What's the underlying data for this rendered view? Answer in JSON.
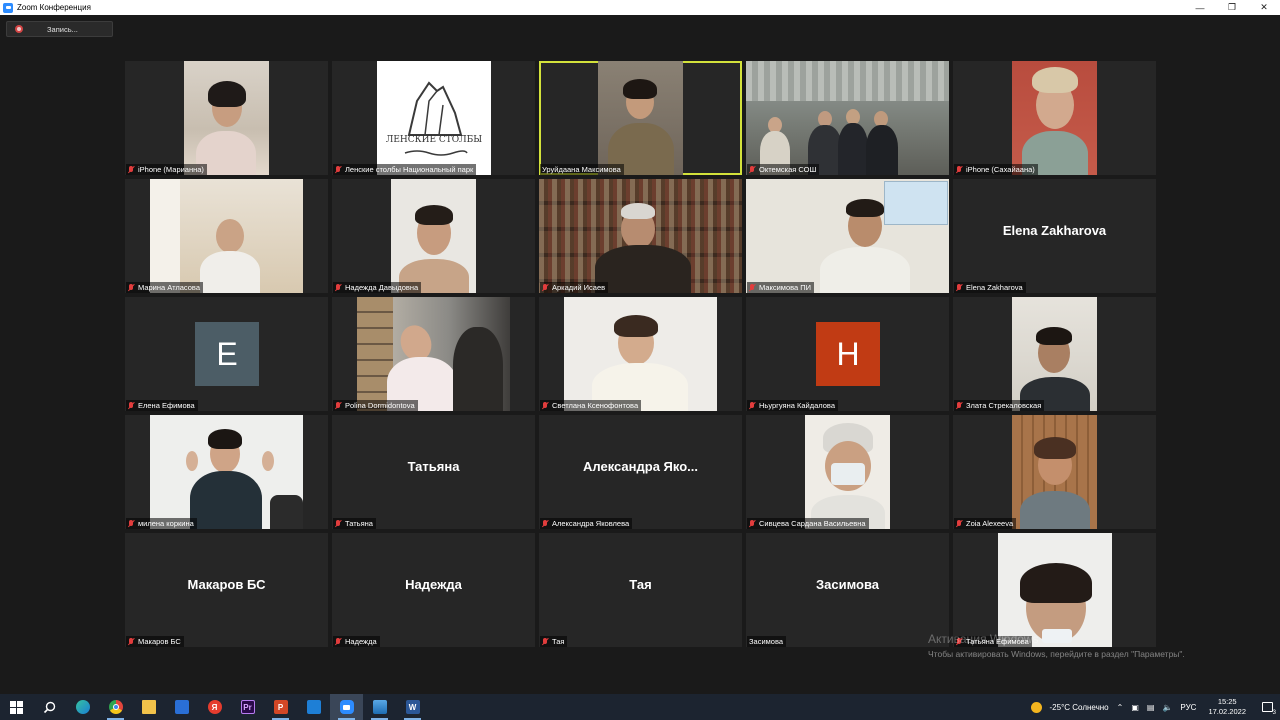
{
  "window": {
    "title": "Zoom Конференция",
    "controls": [
      "minimize-icon",
      "maximize-icon",
      "close-icon"
    ]
  },
  "recording": {
    "label": "Запись..."
  },
  "participants": [
    {
      "name": "iPhone (Марианна)",
      "show": "video"
    },
    {
      "name": "Ленские столбы Национальный парк",
      "show": "logo",
      "logo_text": "ЛЕНСКИЕ СТОЛБЫ"
    },
    {
      "name": "Уруйдаана Максимова",
      "show": "video",
      "active": true
    },
    {
      "name": "Октемская СОШ",
      "show": "video"
    },
    {
      "name": "iPhone (Сахайаана)",
      "show": "video"
    },
    {
      "name": "Марина Атласова",
      "show": "video"
    },
    {
      "name": "Надежда Давыдовна",
      "show": "video"
    },
    {
      "name": "Аркадий Исаев",
      "show": "video"
    },
    {
      "name": "Максимова ПИ",
      "show": "video"
    },
    {
      "name": "Elena Zakharova",
      "show": "name",
      "display": "Elena Zakharova"
    },
    {
      "name": "Елена Ефимова",
      "show": "avatar",
      "initial": "E",
      "color": "#4c5d66"
    },
    {
      "name": "Polina Dormidontova",
      "show": "video"
    },
    {
      "name": "Светлана Ксенофонтова",
      "show": "video"
    },
    {
      "name": "Ньургуяна Кайдалова",
      "show": "avatar",
      "initial": "H",
      "color": "#c13b14"
    },
    {
      "name": "Злата Стрекаловская",
      "show": "video"
    },
    {
      "name": "милена коркина",
      "show": "video"
    },
    {
      "name": "Татьяна",
      "show": "name",
      "display": "Татьяна"
    },
    {
      "name": "Александра Яковлева",
      "show": "name",
      "display": "Александра Яко..."
    },
    {
      "name": "Сивцева Сардана Васильевна",
      "show": "video"
    },
    {
      "name": "Zoia Alexeeva",
      "show": "video"
    },
    {
      "name": "Макаров БС",
      "show": "name",
      "display": "Макаров БС"
    },
    {
      "name": "Надежда",
      "show": "name",
      "display": "Надежда"
    },
    {
      "name": "Тая",
      "show": "name",
      "display": "Тая"
    },
    {
      "name": "Засимова",
      "show": "name",
      "display": "Засимова",
      "unmuted": true
    },
    {
      "name": "Татьяна Ефимова",
      "show": "video"
    }
  ],
  "watermark": {
    "title": "Активация Windows",
    "subtitle": "Чтобы активировать Windows, перейдите в раздел \"Параметры\"."
  },
  "taskbar": {
    "apps": [
      {
        "id": "windows-start-icon"
      },
      {
        "id": "search-icon"
      },
      {
        "id": "edge-icon"
      },
      {
        "id": "chrome-icon"
      },
      {
        "id": "file-explorer-icon"
      },
      {
        "id": "store-icon"
      },
      {
        "id": "yandex-browser-icon"
      },
      {
        "id": "premiere-icon",
        "glyph": "Pr"
      },
      {
        "id": "powerpoint-icon",
        "glyph": "P"
      },
      {
        "id": "movies-icon"
      },
      {
        "id": "zoom-icon"
      },
      {
        "id": "photos-icon"
      },
      {
        "id": "word-icon",
        "glyph": "W"
      }
    ],
    "weather": "-25°C  Солнечно",
    "language": "РУС",
    "time": "15:25",
    "date": "17.02.2022",
    "notification_count": "3"
  }
}
